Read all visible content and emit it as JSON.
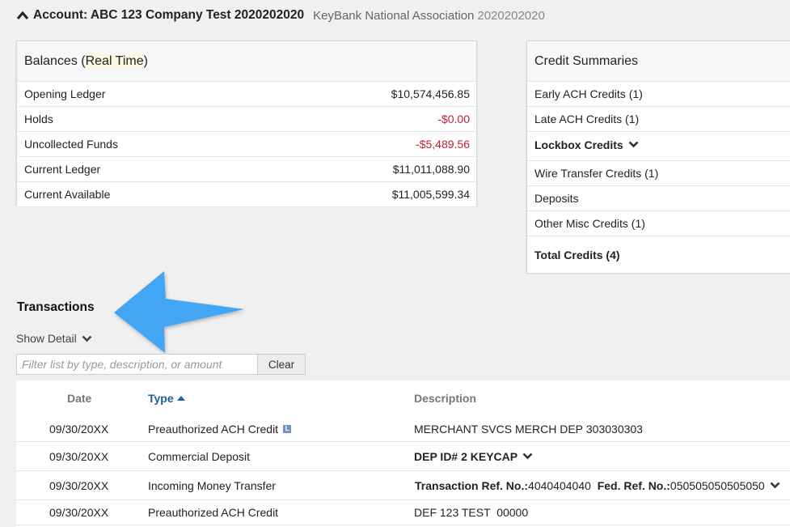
{
  "account": {
    "title": "Account: ABC 123 Company Test 2020202020",
    "bank_name": "KeyBank National Association",
    "bank_number": "2020202020"
  },
  "balances": {
    "title_prefix": "Balances (",
    "title_highlight": "Real Time",
    "title_suffix": ")",
    "rows": [
      {
        "label": "Opening Ledger",
        "value": "$10,574,456.85",
        "negative": false
      },
      {
        "label": "Holds",
        "value": "-$0.00",
        "negative": true
      },
      {
        "label": "Uncollected Funds",
        "value": "-$5,489.56",
        "negative": true
      },
      {
        "label": "Current Ledger",
        "value": "$11,011,088.90",
        "negative": false
      },
      {
        "label": "Current Available",
        "value": "$11,005,599.34",
        "negative": false
      }
    ]
  },
  "credit_summaries": {
    "title": "Credit Summaries",
    "items": [
      {
        "label": "Early ACH Credits (1)"
      },
      {
        "label": "Late ACH Credits (1)"
      },
      {
        "label": "Lockbox Credits"
      },
      {
        "label": "Wire Transfer Credits (1)"
      },
      {
        "label": "Deposits"
      },
      {
        "label": "Other Misc Credits (1)"
      }
    ],
    "total": "Total Credits (4)"
  },
  "transactions": {
    "title": "Transactions",
    "show_detail": "Show Detail",
    "filter_placeholder": "Filter list by type, description, or amount",
    "clear_label": "Clear",
    "columns": {
      "date": "Date",
      "type": "Type",
      "description": "Description"
    },
    "rows": [
      {
        "date": "09/30/20XX",
        "type": "Preauthorized ACH Credit",
        "badge": "L",
        "desc": "MERCHANT SVCS MERCH DEP",
        "desc_num": "303030303"
      },
      {
        "date": "09/30/20XX",
        "type": "Commercial Deposit",
        "desc": "DEP ID# 2 KEYCAP"
      },
      {
        "date": "09/30/20XX",
        "type": "Incoming Money Transfer",
        "ref_label": "Transaction Ref. No.:",
        "ref_value": "4040404040",
        "fed_label": "Fed. Ref. No.:",
        "fed_value": "050505050505050"
      },
      {
        "date": "09/30/20XX",
        "type": "Preauthorized ACH Credit",
        "desc": "DEF 123 TEST  00000"
      }
    ]
  },
  "colors": {
    "negative": "#c0202a",
    "arrow": "#42a6f5",
    "link": "#1b5f9e"
  }
}
